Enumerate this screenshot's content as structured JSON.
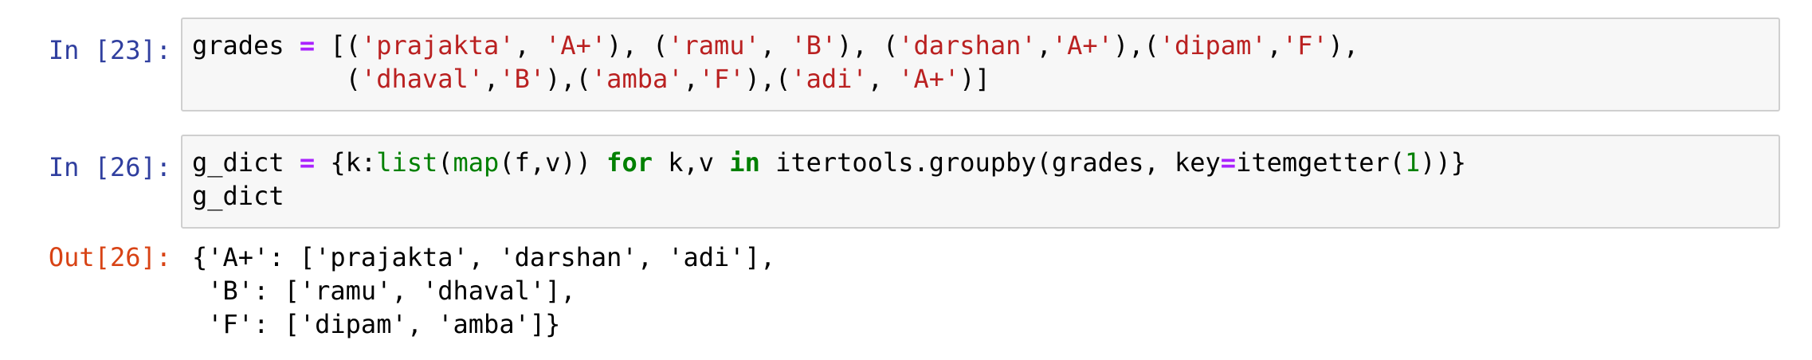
{
  "cells": [
    {
      "prompt": "In [23]:",
      "lines": [
        [
          {
            "t": "grades ",
            "c": "plain"
          },
          {
            "t": "=",
            "c": "op"
          },
          {
            "t": " [(",
            "c": "plain"
          },
          {
            "t": "'prajakta'",
            "c": "str"
          },
          {
            "t": ", ",
            "c": "plain"
          },
          {
            "t": "'A+'",
            "c": "str"
          },
          {
            "t": "), (",
            "c": "plain"
          },
          {
            "t": "'ramu'",
            "c": "str"
          },
          {
            "t": ", ",
            "c": "plain"
          },
          {
            "t": "'B'",
            "c": "str"
          },
          {
            "t": "), (",
            "c": "plain"
          },
          {
            "t": "'darshan'",
            "c": "str"
          },
          {
            "t": ",",
            "c": "plain"
          },
          {
            "t": "'A+'",
            "c": "str"
          },
          {
            "t": "),(",
            "c": "plain"
          },
          {
            "t": "'dipam'",
            "c": "str"
          },
          {
            "t": ",",
            "c": "plain"
          },
          {
            "t": "'F'",
            "c": "str"
          },
          {
            "t": "),",
            "c": "plain"
          }
        ],
        [
          {
            "t": "          (",
            "c": "plain"
          },
          {
            "t": "'dhaval'",
            "c": "str"
          },
          {
            "t": ",",
            "c": "plain"
          },
          {
            "t": "'B'",
            "c": "str"
          },
          {
            "t": "),(",
            "c": "plain"
          },
          {
            "t": "'amba'",
            "c": "str"
          },
          {
            "t": ",",
            "c": "plain"
          },
          {
            "t": "'F'",
            "c": "str"
          },
          {
            "t": "),(",
            "c": "plain"
          },
          {
            "t": "'adi'",
            "c": "str"
          },
          {
            "t": ", ",
            "c": "plain"
          },
          {
            "t": "'A+'",
            "c": "str"
          },
          {
            "t": ")]",
            "c": "plain"
          }
        ]
      ]
    },
    {
      "prompt": "In [26]:",
      "lines": [
        [
          {
            "t": "g_dict ",
            "c": "plain"
          },
          {
            "t": "=",
            "c": "op"
          },
          {
            "t": " {k:",
            "c": "plain"
          },
          {
            "t": "list",
            "c": "bi"
          },
          {
            "t": "(",
            "c": "plain"
          },
          {
            "t": "map",
            "c": "bi"
          },
          {
            "t": "(f,v)) ",
            "c": "plain"
          },
          {
            "t": "for",
            "c": "kw"
          },
          {
            "t": " k,v ",
            "c": "plain"
          },
          {
            "t": "in",
            "c": "kw"
          },
          {
            "t": " itertools.groupby(grades, key",
            "c": "plain"
          },
          {
            "t": "=",
            "c": "op"
          },
          {
            "t": "itemgetter(",
            "c": "plain"
          },
          {
            "t": "1",
            "c": "num"
          },
          {
            "t": "))}",
            "c": "plain"
          }
        ],
        [
          {
            "t": "g_dict",
            "c": "plain"
          }
        ]
      ],
      "output": {
        "prompt": "Out[26]:",
        "lines": [
          "{'A+': ['prajakta', 'darshan', 'adi'],",
          " 'B': ['ramu', 'dhaval'],",
          " 'F': ['dipam', 'amba']}"
        ]
      }
    }
  ]
}
